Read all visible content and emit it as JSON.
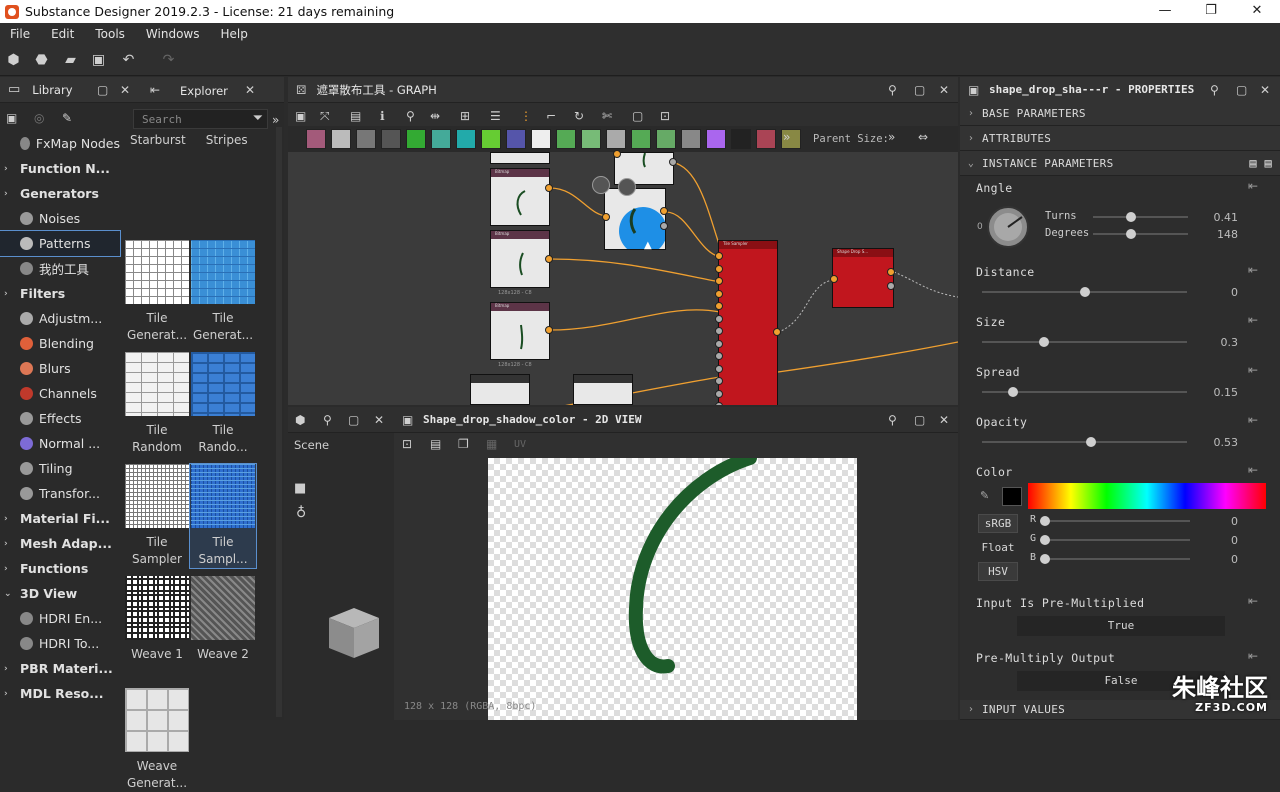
{
  "window": {
    "title": "Substance Designer 2019.2.3 - License: 21 days remaining"
  },
  "menu": [
    "File",
    "Edit",
    "Tools",
    "Windows",
    "Help"
  ],
  "library": {
    "tab_library": "Library",
    "tab_explorer": "Explorer",
    "search_placeholder": "Search",
    "tree": [
      {
        "label": "FxMap Nodes",
        "kind": "item",
        "color": "#888"
      },
      {
        "label": "Function N...",
        "kind": "cat"
      },
      {
        "label": "Generators",
        "kind": "cat"
      },
      {
        "label": "Noises",
        "kind": "item",
        "color": "#999"
      },
      {
        "label": "Patterns",
        "kind": "item",
        "color": "#bbb",
        "selected": true
      },
      {
        "label": "我的工具",
        "kind": "item",
        "color": "#888"
      },
      {
        "label": "Filters",
        "kind": "cat"
      },
      {
        "label": "Adjustm...",
        "kind": "item",
        "color": "#aaa"
      },
      {
        "label": "Blending",
        "kind": "item",
        "color": "#e0603a"
      },
      {
        "label": "Blurs",
        "kind": "item",
        "color": "#d75"
      },
      {
        "label": "Channels",
        "kind": "item",
        "color": "#c0392b"
      },
      {
        "label": "Effects",
        "kind": "item",
        "color": "#999"
      },
      {
        "label": "Normal ...",
        "kind": "item",
        "color": "#7d6bd6"
      },
      {
        "label": "Tiling",
        "kind": "item",
        "color": "#999"
      },
      {
        "label": "Transfor...",
        "kind": "item",
        "color": "#999"
      },
      {
        "label": "Material Fi...",
        "kind": "cat"
      },
      {
        "label": "Mesh Adap...",
        "kind": "cat"
      },
      {
        "label": "Functions",
        "kind": "cat"
      },
      {
        "label": "3D View",
        "kind": "cat",
        "open": true
      },
      {
        "label": "HDRI En...",
        "kind": "item",
        "color": "#888"
      },
      {
        "label": "HDRI To...",
        "kind": "item",
        "color": "#888"
      },
      {
        "label": "PBR Materi...",
        "kind": "cat"
      },
      {
        "label": "MDL Reso...",
        "kind": "cat"
      }
    ],
    "thumb_header": [
      "Starburst",
      "Stripes"
    ],
    "thumbs": [
      {
        "l1": "Tile",
        "l2": "Generat...",
        "style": "grid-white"
      },
      {
        "l1": "Tile",
        "l2": "Generat...",
        "style": "mosaic-blue"
      },
      {
        "l1": "Tile",
        "l2": "Random",
        "style": "bricks-white"
      },
      {
        "l1": "Tile",
        "l2": "Rando...",
        "style": "bricks-blue"
      },
      {
        "l1": "Tile",
        "l2": "Sampler",
        "style": "fine-grid"
      },
      {
        "l1": "Tile",
        "l2": "Sampl...",
        "style": "fine-blue",
        "selected": true
      },
      {
        "l1": "Weave 1",
        "l2": "",
        "style": "weave1"
      },
      {
        "l1": "Weave 2",
        "l2": "",
        "style": "weave2"
      },
      {
        "l1": "Weave",
        "l2": "Generat...",
        "style": "weave-gen"
      }
    ]
  },
  "graph": {
    "title": "遮罩散布工具 - GRAPH",
    "parent_size_label": "Parent Size:",
    "nodes": {
      "bitmap": "Bitmap",
      "res": "128x128 - C8",
      "tile_sampler": "Tile Sampler",
      "shape_drop": "Shape Drop S..."
    }
  },
  "view2d": {
    "title": "Shape_drop_shadow_color - 2D VIEW",
    "scene_label": "Scene",
    "uv_label": "UV",
    "status": "128 x 128 (RGBA, 8bpc)"
  },
  "props": {
    "title": "shape_drop_sha---r - PROPERTIES",
    "sections": {
      "base": "BASE PARAMETERS",
      "attributes": "ATTRIBUTES",
      "instance": "INSTANCE PARAMETERS",
      "input": "INPUT VALUES"
    },
    "angle": {
      "label": "Angle",
      "turns_label": "Turns",
      "turns": "0.41",
      "degrees_label": "Degrees",
      "degrees": "148",
      "zero": "0"
    },
    "distance": {
      "label": "Distance",
      "value": "0",
      "fraction": 0.5
    },
    "size": {
      "label": "Size",
      "value": "0.3",
      "fraction": 0.3
    },
    "spread": {
      "label": "Spread",
      "value": "0.15",
      "fraction": 0.15
    },
    "opacity": {
      "label": "Opacity",
      "value": "0.53",
      "fraction": 0.53
    },
    "color": {
      "label": "Color",
      "srgb": "sRGB",
      "float": "Float",
      "hsv": "HSV",
      "r": "R",
      "g": "G",
      "b": "B",
      "rv": "0",
      "gv": "0",
      "bv": "0"
    },
    "premult_in": {
      "label": "Input Is Pre-Multiplied",
      "value": "True"
    },
    "premult_out": {
      "label": "Pre-Multiply Output",
      "value": "False"
    }
  },
  "watermark": {
    "cn": "朱峰社区",
    "url": "ZF3D.COM"
  }
}
